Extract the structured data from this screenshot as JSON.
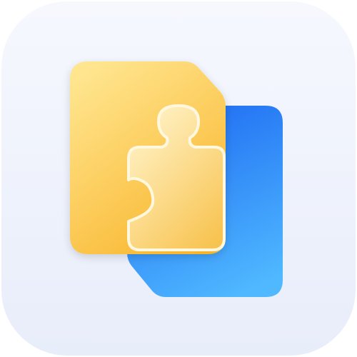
{
  "app_icon": {
    "icon": "puzzle-document-icon",
    "colors": {
      "tile_background_top": "#F6F8FE",
      "tile_background_bottom": "#E8EDFA",
      "blue_document_top": "#1F6CF2",
      "blue_document_bottom": "#4FB8FF",
      "yellow_document_top": "#FFE58E",
      "yellow_document_bottom": "#F9B52C",
      "puzzle_piece_light": "#FFF3C8",
      "puzzle_piece_dark": "#F8C24D",
      "puzzle_outline": "#FFF7DE"
    }
  }
}
